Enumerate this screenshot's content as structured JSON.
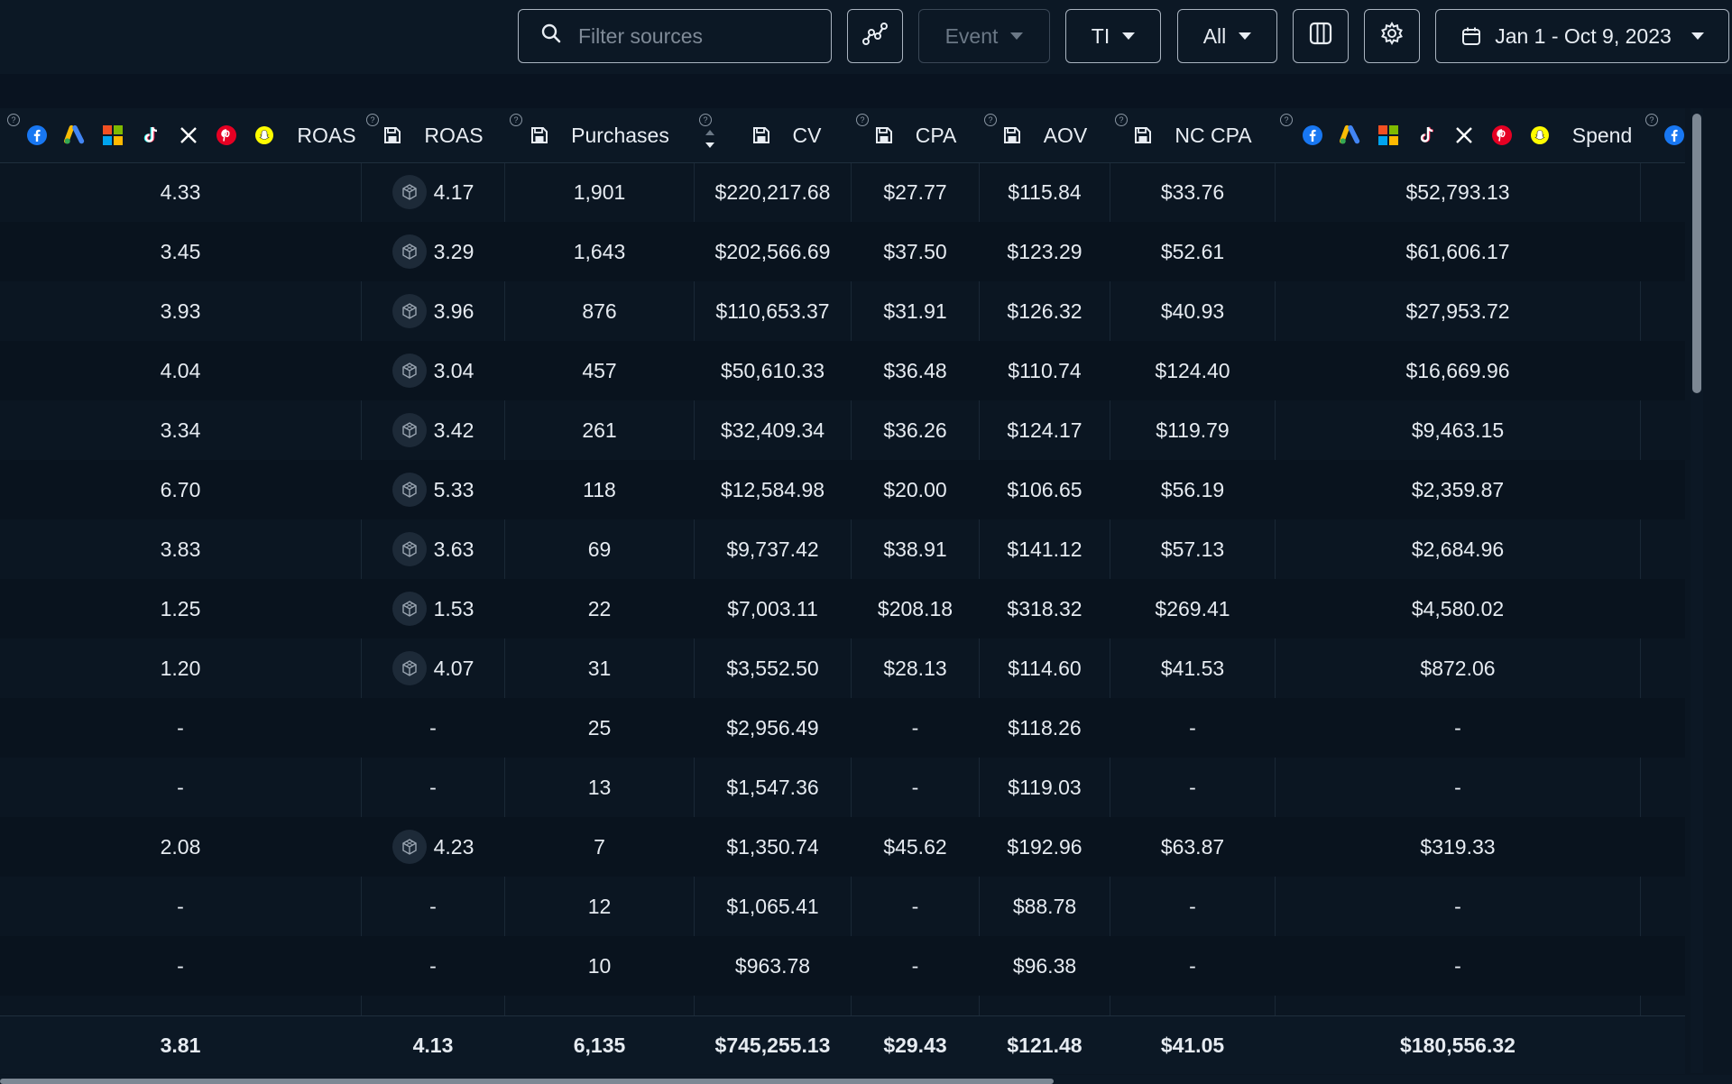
{
  "toolbar": {
    "search_placeholder": "Filter sources",
    "event_label": "Event",
    "model_label": "TI",
    "window_label": "All",
    "date_range": "Jan 1 - Oct 9, 2023"
  },
  "icons": {
    "search": "search-icon",
    "graph": "graph-icon",
    "columns": "columns-icon",
    "settings": "gear-icon",
    "calendar": "calendar-icon",
    "floppy": "floppy-icon",
    "cube": "cube-icon"
  },
  "colors": {
    "facebook": "#1877f2",
    "pinterest": "#e60023",
    "snapchat": "#fffc00",
    "background": "#0b1622"
  },
  "columns": {
    "platform_roas": "ROAS",
    "roas": "ROAS",
    "purchases": "Purchases",
    "cv": "CV",
    "cpa": "CPA",
    "aov": "AOV",
    "nc_cpa": "NC CPA",
    "spend": "Spend"
  },
  "rows": [
    [
      "4.33",
      "4.17",
      "1,901",
      "$220,217.68",
      "$27.77",
      "$115.84",
      "$33.76",
      "$52,793.13"
    ],
    [
      "3.45",
      "3.29",
      "1,643",
      "$202,566.69",
      "$37.50",
      "$123.29",
      "$52.61",
      "$61,606.17"
    ],
    [
      "3.93",
      "3.96",
      "876",
      "$110,653.37",
      "$31.91",
      "$126.32",
      "$40.93",
      "$27,953.72"
    ],
    [
      "4.04",
      "3.04",
      "457",
      "$50,610.33",
      "$36.48",
      "$110.74",
      "$124.40",
      "$16,669.96"
    ],
    [
      "3.34",
      "3.42",
      "261",
      "$32,409.34",
      "$36.26",
      "$124.17",
      "$119.79",
      "$9,463.15"
    ],
    [
      "6.70",
      "5.33",
      "118",
      "$12,584.98",
      "$20.00",
      "$106.65",
      "$56.19",
      "$2,359.87"
    ],
    [
      "3.83",
      "3.63",
      "69",
      "$9,737.42",
      "$38.91",
      "$141.12",
      "$57.13",
      "$2,684.96"
    ],
    [
      "1.25",
      "1.53",
      "22",
      "$7,003.11",
      "$208.18",
      "$318.32",
      "$269.41",
      "$4,580.02"
    ],
    [
      "1.20",
      "4.07",
      "31",
      "$3,552.50",
      "$28.13",
      "$114.60",
      "$41.53",
      "$872.06"
    ],
    [
      "-",
      "-",
      "25",
      "$2,956.49",
      "-",
      "$118.26",
      "-",
      "-"
    ],
    [
      "-",
      "-",
      "13",
      "$1,547.36",
      "-",
      "$119.03",
      "-",
      "-"
    ],
    [
      "2.08",
      "4.23",
      "7",
      "$1,350.74",
      "$45.62",
      "$192.96",
      "$63.87",
      "$319.33"
    ],
    [
      "-",
      "-",
      "12",
      "$1,065.41",
      "-",
      "$88.78",
      "-",
      "-"
    ],
    [
      "-",
      "-",
      "10",
      "$963.78",
      "-",
      "$96.38",
      "-",
      "-"
    ]
  ],
  "totals": [
    "3.81",
    "4.13",
    "6,135",
    "$745,255.13",
    "$29.43",
    "$121.48",
    "$41.05",
    "$180,556.32"
  ]
}
